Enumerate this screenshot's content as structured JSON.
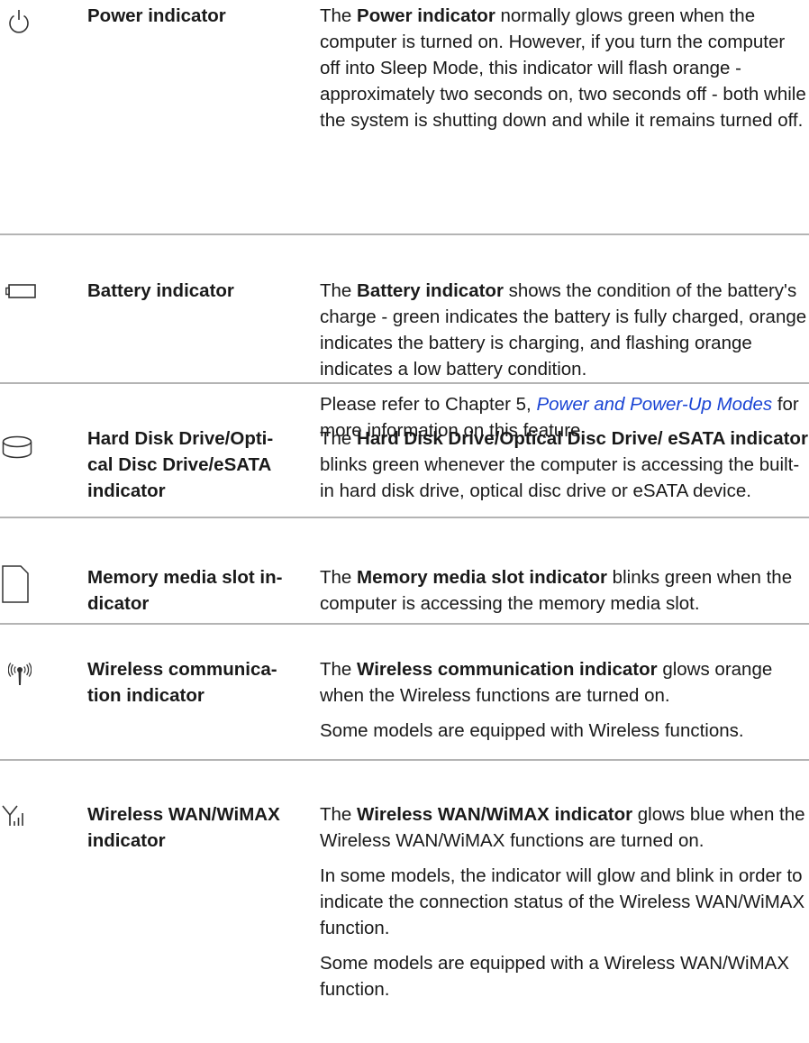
{
  "rows": [
    {
      "icon": "power-icon",
      "term": [
        "Power indicator"
      ],
      "paragraphs": [
        [
          {
            "t": "The "
          },
          {
            "t": "Power indicator",
            "b": true
          },
          {
            "t": " normally glows green when the computer is turned on. However, if you turn the computer off into Sleep Mode, this indicator will flash orange - approximately two seconds on, two seconds off - both while the system is shutting down and while it remains turned off."
          }
        ]
      ]
    },
    {
      "icon": "battery-icon",
      "term": [
        "Battery indicator"
      ],
      "paragraphs": [
        [
          {
            "t": "The "
          },
          {
            "t": "Battery indicator",
            "b": true
          },
          {
            "t": " shows the condition of the battery's charge - green indicates the battery is fully charged, orange indicates the battery is charging, and flashing orange indicates a low battery condition."
          }
        ],
        [
          {
            "t": "Please refer to Chapter 5, "
          },
          {
            "t": "Power and Power-Up Modes",
            "link": true
          },
          {
            "t": " for more information on this feature."
          }
        ]
      ]
    },
    {
      "icon": "hard-disk-icon",
      "term": [
        "Hard Disk Drive/Opti-",
        "cal Disc Drive/eSATA",
        "indicator"
      ],
      "paragraphs": [
        [
          {
            "t": "The "
          },
          {
            "t": "Hard Disk Drive/Optical Disc Drive/ eSATA indicator",
            "b": true
          },
          {
            "t": " blinks green whenever the computer is accessing the built-in hard disk drive, optical disc drive or eSATA device."
          }
        ]
      ]
    },
    {
      "icon": "memory-card-icon",
      "term": [
        "Memory media slot in-",
        "dicator"
      ],
      "paragraphs": [
        [
          {
            "t": "The "
          },
          {
            "t": "Memory media slot indicator",
            "b": true
          },
          {
            "t": " blinks green when the computer is accessing the memory media slot."
          }
        ]
      ]
    },
    {
      "icon": "wireless-icon",
      "term": [
        "Wireless communica-",
        "tion indicator"
      ],
      "paragraphs": [
        [
          {
            "t": "The "
          },
          {
            "t": "Wireless communication indicator",
            "b": true
          },
          {
            "t": " glows orange when the Wireless functions are turned on."
          }
        ],
        [
          {
            "t": "Some models are equipped with Wireless functions."
          }
        ]
      ]
    },
    {
      "icon": "wan-signal-icon",
      "term": [
        "Wireless WAN/WiMAX",
        "indicator"
      ],
      "paragraphs": [
        [
          {
            "t": "The "
          },
          {
            "t": "Wireless WAN/WiMAX indicator",
            "b": true
          },
          {
            "t": " glows blue when the Wireless WAN/WiMAX functions are turned on."
          }
        ],
        [
          {
            "t": "In some models, the indicator will glow and blink in order to indicate the connection status of the Wireless WAN/WiMAX function."
          }
        ],
        [
          {
            "t": "Some models are equipped with a Wireless WAN/WiMAX function."
          }
        ]
      ]
    }
  ]
}
